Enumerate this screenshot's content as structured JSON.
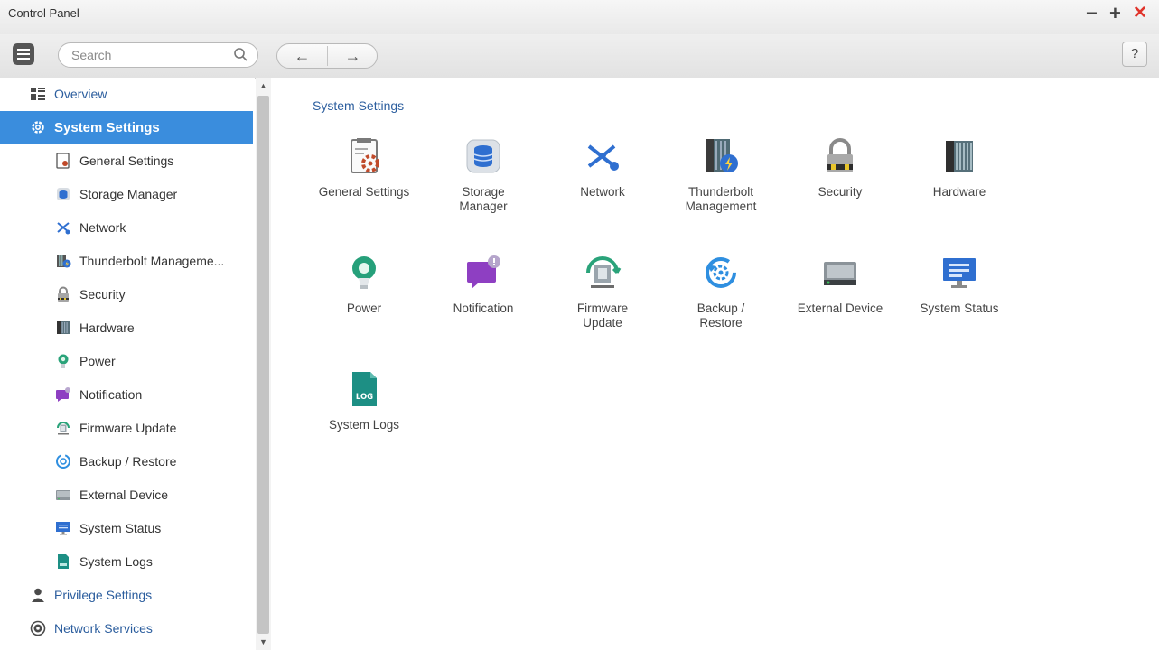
{
  "window": {
    "title": "Control Panel"
  },
  "toolbar": {
    "search_placeholder": "Search",
    "back_symbol": "←",
    "forward_symbol": "→",
    "help_label": "?"
  },
  "window_controls": {
    "minimize": "−",
    "maximize": "+",
    "close": "✕"
  },
  "sidebar": {
    "overview": "Overview",
    "system_settings": "System Settings",
    "items": [
      "General Settings",
      "Storage Manager",
      "Network",
      "Thunderbolt Manageme...",
      "Security",
      "Hardware",
      "Power",
      "Notification",
      "Firmware Update",
      "Backup / Restore",
      "External Device",
      "System Status",
      "System Logs"
    ],
    "privilege_settings": "Privilege Settings",
    "network_services": "Network Services"
  },
  "main": {
    "section_title": "System Settings",
    "tiles": [
      {
        "line1": "General Settings",
        "line2": ""
      },
      {
        "line1": "Storage",
        "line2": "Manager"
      },
      {
        "line1": "Network",
        "line2": ""
      },
      {
        "line1": "Thunderbolt",
        "line2": "Management"
      },
      {
        "line1": "Security",
        "line2": ""
      },
      {
        "line1": "Hardware",
        "line2": ""
      },
      {
        "line1": "Power",
        "line2": ""
      },
      {
        "line1": "Notification",
        "line2": ""
      },
      {
        "line1": "Firmware",
        "line2": "Update"
      },
      {
        "line1": "Backup /",
        "line2": "Restore"
      },
      {
        "line1": "External Device",
        "line2": ""
      },
      {
        "line1": "System Status",
        "line2": ""
      },
      {
        "line1": "System Logs",
        "line2": ""
      }
    ],
    "log_badge": "LOG"
  },
  "colors": {
    "accent": "#3a8ddd",
    "category_text": "#2c5e9e",
    "close": "#e0342b"
  }
}
